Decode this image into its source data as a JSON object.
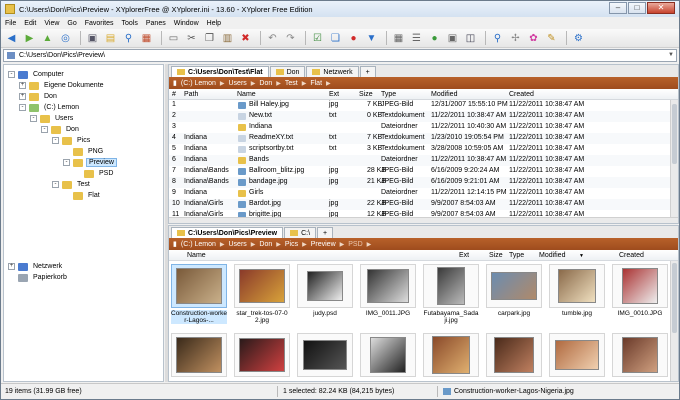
{
  "window": {
    "title": "C:\\Users\\Don\\Pics\\Preview - XYplorerFree @ XYplorer.ini - 13.60 - XYplorer Free Edition"
  },
  "menu": [
    "File",
    "Edit",
    "View",
    "Go",
    "Favorites",
    "Tools",
    "Panes",
    "Window",
    "Help"
  ],
  "address": {
    "value": "C:\\Users\\Don\\Pics\\Preview\\"
  },
  "tree": [
    {
      "label": "Computer",
      "indent": 0,
      "exp": "-",
      "color": "#4a7bd0"
    },
    {
      "label": "Eigene Dokumente",
      "indent": 1,
      "exp": "+",
      "color": "#e8c14a"
    },
    {
      "label": "Don",
      "indent": 1,
      "exp": "+",
      "color": "#e8c14a"
    },
    {
      "label": "(C:) Lemon",
      "indent": 1,
      "exp": "-",
      "color": "#8fc36b"
    },
    {
      "label": "Users",
      "indent": 2,
      "exp": "-",
      "color": "#e8c14a"
    },
    {
      "label": "Don",
      "indent": 3,
      "exp": "-",
      "color": "#e8c14a"
    },
    {
      "label": "Pics",
      "indent": 4,
      "exp": "-",
      "color": "#e8c14a"
    },
    {
      "label": "PNG",
      "indent": 5,
      "exp": "",
      "color": "#e8c14a"
    },
    {
      "label": "Preview",
      "indent": 5,
      "exp": "-",
      "color": "#e8c14a",
      "selected": true
    },
    {
      "label": "PSD",
      "indent": 6,
      "exp": "",
      "color": "#e8c14a"
    },
    {
      "label": "Test",
      "indent": 4,
      "exp": "-",
      "color": "#e8c14a"
    },
    {
      "label": "Flat",
      "indent": 5,
      "exp": "",
      "color": "#e8c14a"
    },
    {
      "label": "Netzwerk",
      "indent": 0,
      "exp": "+",
      "color": "#4a7bd0"
    },
    {
      "label": "Papierkorb",
      "indent": 0,
      "exp": "",
      "color": "#9aa5b2"
    }
  ],
  "pane1": {
    "tabs": [
      "C:\\Users\\Don\\Test\\Flat",
      "Don",
      "Netzwerk",
      "+"
    ],
    "crumbs": [
      "(C:) Lemon",
      "Users",
      "Don",
      "Test",
      "Flat"
    ],
    "columns": [
      "#",
      "Path",
      "Name",
      "Ext",
      "Size",
      "Type",
      "Modified",
      "Created"
    ],
    "rows": [
      {
        "n": "1",
        "path": "",
        "name": "Bill Haley.jpg",
        "ext": "jpg",
        "size": "7 KB",
        "type": "JPEG-Bild",
        "mod": "12/31/2007 15:55:10 PM",
        "cre": "11/22/2011 10:38:47 AM",
        "icon": "img"
      },
      {
        "n": "2",
        "path": "",
        "name": "New.txt",
        "ext": "txt",
        "size": "0 KB",
        "type": "Textdokument",
        "mod": "11/22/2011 10:38:47 AM",
        "cre": "11/22/2011 10:38:47 AM",
        "icon": "txt"
      },
      {
        "n": "3",
        "path": "",
        "name": "Indiana",
        "ext": "",
        "size": "",
        "type": "Dateiordner",
        "mod": "11/22/2011 10:40:30 AM",
        "cre": "11/22/2011 10:38:47 AM",
        "icon": "folder"
      },
      {
        "n": "4",
        "path": "Indiana",
        "name": "ReadmeXY.txt",
        "ext": "txt",
        "size": "7 KB",
        "type": "Textdokument",
        "mod": "1/23/2010 19:05:54 PM",
        "cre": "11/22/2011 10:38:47 AM",
        "icon": "txt"
      },
      {
        "n": "5",
        "path": "Indiana",
        "name": "scriptsortby.txt",
        "ext": "txt",
        "size": "3 KB",
        "type": "Textdokument",
        "mod": "3/28/2008 10:59:05 AM",
        "cre": "11/22/2011 10:38:47 AM",
        "icon": "txt"
      },
      {
        "n": "6",
        "path": "Indiana",
        "name": "Bands",
        "ext": "",
        "size": "",
        "type": "Dateiordner",
        "mod": "11/22/2011 10:38:47 AM",
        "cre": "11/22/2011 10:38:47 AM",
        "icon": "folder"
      },
      {
        "n": "7",
        "path": "Indiana\\Bands",
        "name": "Ballroom_blitz.jpg",
        "ext": "jpg",
        "size": "28 KB",
        "type": "JPEG-Bild",
        "mod": "6/16/2009 9:20:24 AM",
        "cre": "11/22/2011 10:38:47 AM",
        "icon": "img"
      },
      {
        "n": "8",
        "path": "Indiana\\Bands",
        "name": "bandage.jpg",
        "ext": "jpg",
        "size": "21 KB",
        "type": "JPEG-Bild",
        "mod": "6/16/2009 9:21:01 AM",
        "cre": "11/22/2011 10:38:47 AM",
        "icon": "img"
      },
      {
        "n": "9",
        "path": "Indiana",
        "name": "Girls",
        "ext": "",
        "size": "",
        "type": "Dateiordner",
        "mod": "11/22/2011 12:14:15 PM",
        "cre": "11/22/2011 10:38:47 AM",
        "icon": "folder"
      },
      {
        "n": "10",
        "path": "Indiana\\Girls",
        "name": "Bardot.jpg",
        "ext": "jpg",
        "size": "22 KB",
        "type": "JPEG-Bild",
        "mod": "9/9/2007 8:54:03 AM",
        "cre": "11/22/2011 10:38:47 AM",
        "icon": "img"
      },
      {
        "n": "11",
        "path": "Indiana\\Girls",
        "name": "brigitte.jpg",
        "ext": "jpg",
        "size": "12 KB",
        "type": "JPEG-Bild",
        "mod": "9/9/2007 8:54:03 AM",
        "cre": "11/22/2011 10:38:47 AM",
        "icon": "img"
      }
    ]
  },
  "pane2": {
    "tabs": [
      "C:\\Users\\Don\\Pics\\Preview",
      "C:\\",
      "+"
    ],
    "crumbs": [
      "(C:) Lemon",
      "Users",
      "Don",
      "Pics",
      "Preview",
      "PSD"
    ],
    "columns": [
      "Name",
      "Ext",
      "Size",
      "Type",
      "Modified",
      "Created"
    ],
    "thumbs_row1": [
      {
        "label": "Construction-worker-Lagos-...",
        "c1": "#7a5a3a",
        "c2": "#c9b08a",
        "w": 46,
        "h": 36,
        "sel": true
      },
      {
        "label": "star_trek-tos-07-02.jpg",
        "c1": "#8a3a2a",
        "c2": "#d8a23a",
        "w": 46,
        "h": 34
      },
      {
        "label": "judy.psd",
        "c1": "#222",
        "c2": "#eee",
        "w": 36,
        "h": 30
      },
      {
        "label": "IMG_0011.JPG",
        "c1": "#333",
        "c2": "#ddd",
        "w": 42,
        "h": 34
      },
      {
        "label": "Futabayama_Sadaji.jpg",
        "c1": "#3a3a3a",
        "c2": "#bbb",
        "w": 28,
        "h": 38
      },
      {
        "label": "carpark.jpg",
        "c1": "#6b8cb0",
        "c2": "#b08a6a",
        "w": 46,
        "h": 28
      },
      {
        "label": "tumble.jpg",
        "c1": "#8a6a4a",
        "c2": "#f0e0c0",
        "w": 38,
        "h": 34
      },
      {
        "label": "IMG_0010.JPG",
        "c1": "#a33",
        "c2": "#eee",
        "w": 36,
        "h": 36
      }
    ],
    "thumbs_row2": [
      {
        "c1": "#3a2a1a",
        "c2": "#c09060",
        "w": 46,
        "h": 36
      },
      {
        "c1": "#2a1a1a",
        "c2": "#d04040",
        "w": 46,
        "h": 34
      },
      {
        "c1": "#111",
        "c2": "#555",
        "w": 44,
        "h": 30
      },
      {
        "c1": "#ddd",
        "c2": "#222",
        "w": 36,
        "h": 36
      },
      {
        "c1": "#8a4a2a",
        "c2": "#e0b070",
        "w": 38,
        "h": 38
      },
      {
        "c1": "#4a2a1a",
        "c2": "#c08060",
        "w": 40,
        "h": 36
      },
      {
        "c1": "#b06a40",
        "c2": "#f0d0b0",
        "w": 44,
        "h": 30
      },
      {
        "c1": "#6a3a2a",
        "c2": "#d0a080",
        "w": 36,
        "h": 36
      }
    ]
  },
  "status": {
    "items": "19 items (31.99 GB free)",
    "selected": "1 selected: 82.24 KB (84,215 bytes)",
    "file": "Construction-worker-Lagos-Nigeria.jpg"
  }
}
